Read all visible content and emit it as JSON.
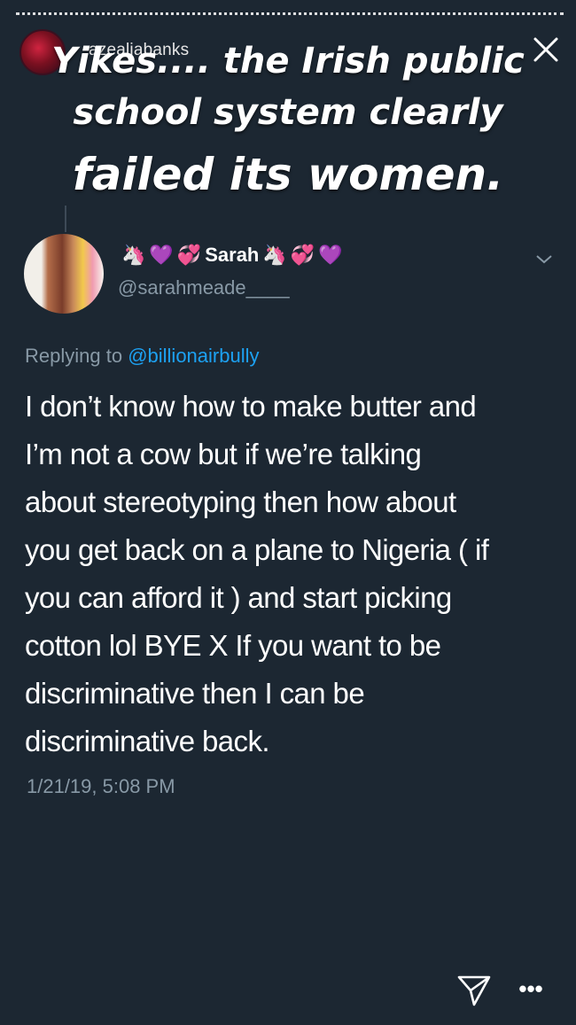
{
  "story": {
    "username": "azealiabanks",
    "caption_lines": [
      "Yikes.... the Irish public",
      "school system clearly",
      "failed its women."
    ]
  },
  "tweet": {
    "display_name": "Sarah",
    "handle": "@sarahmeade____",
    "replying_to_label": "Replying to",
    "replying_to_handle": "@billionairbully",
    "text_lines": [
      "I don’t know how to make butter and",
      "I’m not a cow but if we’re talking",
      "about stereotyping then how about",
      "you get back on a plane to Nigeria ( if",
      "you can afford it ) and start picking",
      "cotton lol BYE X If you want to be",
      "discriminative then I can be",
      "discriminative back."
    ],
    "timestamp": "1/21/19, 5:08 PM"
  },
  "icons": {
    "close": "close-icon",
    "send": "send-icon",
    "more": "more-icon",
    "chevron": "chevron-down-icon",
    "unicorn": "🦄",
    "purple_heart": "💜",
    "sparkle_heart": "💞"
  },
  "more_glyph": "•••",
  "colors": {
    "background": "#1c2732",
    "secondary_text": "#8899a6",
    "link": "#1da1f2"
  }
}
